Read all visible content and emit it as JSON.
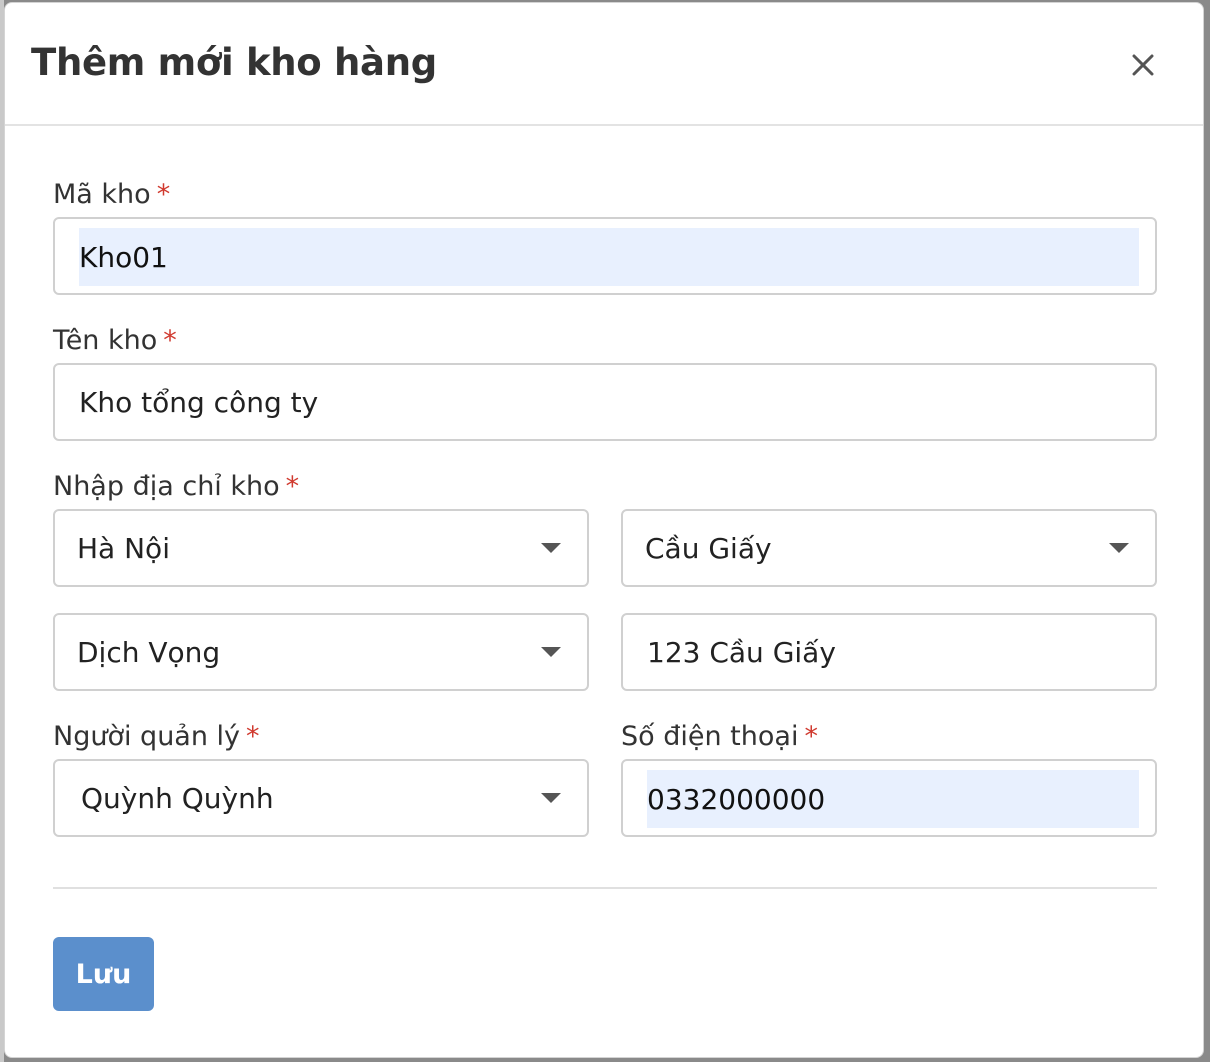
{
  "modal": {
    "title": "Thêm mới kho hàng",
    "close_icon": "close-icon"
  },
  "form": {
    "warehouse_code": {
      "label": "Mã kho",
      "required_mark": "*",
      "value": "Kho01"
    },
    "warehouse_name": {
      "label": "Tên kho",
      "required_mark": "*",
      "value": "Kho tổng công ty"
    },
    "address": {
      "label": "Nhập địa chỉ kho",
      "required_mark": "*",
      "province": "Hà Nội",
      "district": "Cầu Giấy",
      "ward": "Dịch Vọng",
      "street": "123 Cầu Giấy"
    },
    "manager": {
      "label": "Người quản lý",
      "required_mark": "*",
      "value": "Quỳnh Quỳnh"
    },
    "phone": {
      "label": "Số điện thoại",
      "required_mark": "*",
      "value": "0332000000"
    }
  },
  "actions": {
    "save_label": "Lưu"
  },
  "colors": {
    "primary_button": "#5b8fcc",
    "required": "#d03a2f",
    "autofill_bg": "#e8f0fe"
  }
}
